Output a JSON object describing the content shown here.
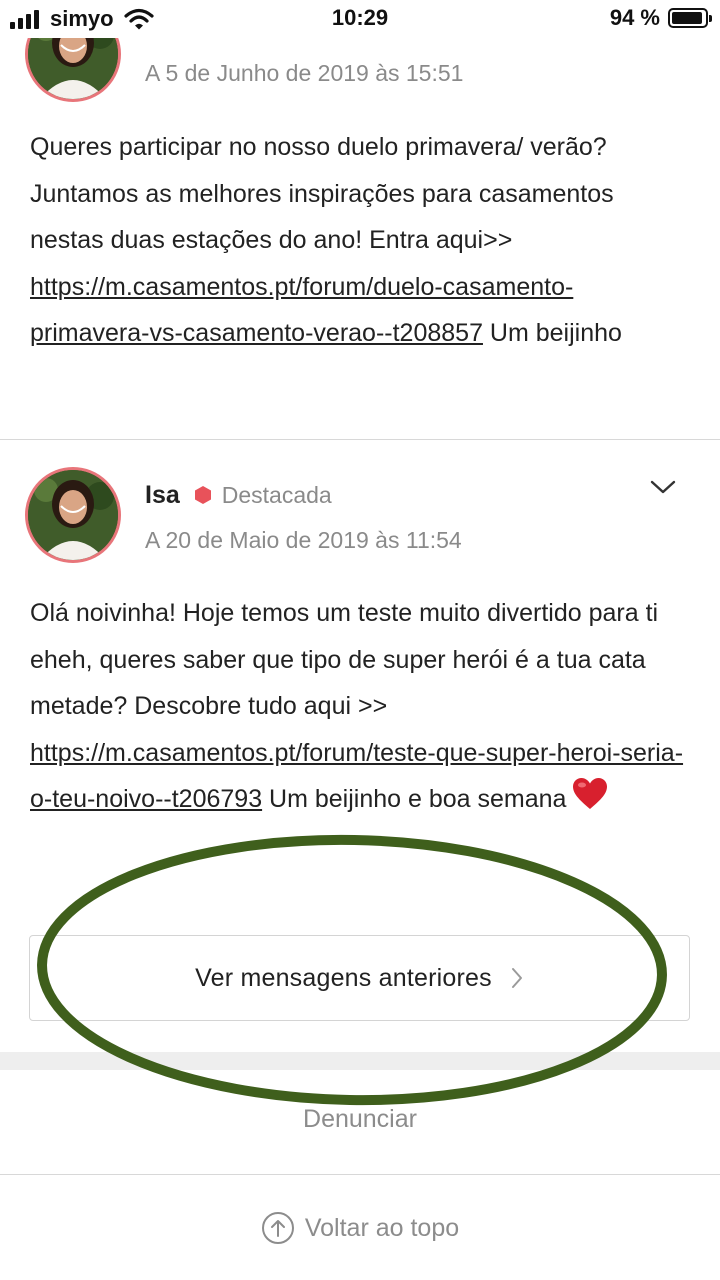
{
  "status_bar": {
    "carrier": "simyo",
    "time": "10:29",
    "battery_percent": "94 %",
    "battery_level": 0.94
  },
  "posts": [
    {
      "date": "A 5 de Junho de 2019 às 15:51",
      "body_text": "Queres participar no nosso duelo primavera/ verão? Juntamos as melhores inspirações para casamentos nestas duas estações do ano! Entra aqui>>",
      "link": "https://m.casamentos.pt/forum/duelo-casamento-primavera-vs-casamento-verao--t208857",
      "body_end": "Um beijinho"
    },
    {
      "author": "Isa",
      "badge": "Destacada",
      "date": "A 20 de Maio de 2019 às 11:54",
      "body_text": "Olá noivinha! Hoje temos um teste muito divertido para ti eheh, queres saber que tipo de super herói é a tua cata metade? Descobre tudo aqui >>",
      "link": "https://m.casamentos.pt/forum/teste-que-super-heroi-seria-o-teu-noivo--t206793",
      "body_end": "Um beijinho e boa semana"
    }
  ],
  "load_more": {
    "label": "Ver mensagens anteriores"
  },
  "footer": {
    "report": "Denunciar",
    "back_to_top": "Voltar ao topo"
  },
  "icons": {
    "badge": "hexagon-icon",
    "options": "chevron-down-icon",
    "load_more": "chevron-right-icon",
    "back_to_top": "arrow-up-circle-icon",
    "heart": "heart-icon"
  },
  "colors": {
    "avatar_border": "#e8757a",
    "badge": "#e8525a",
    "muted_text": "#8a8a8a",
    "annotation_ellipse": "#3f5f1c"
  }
}
